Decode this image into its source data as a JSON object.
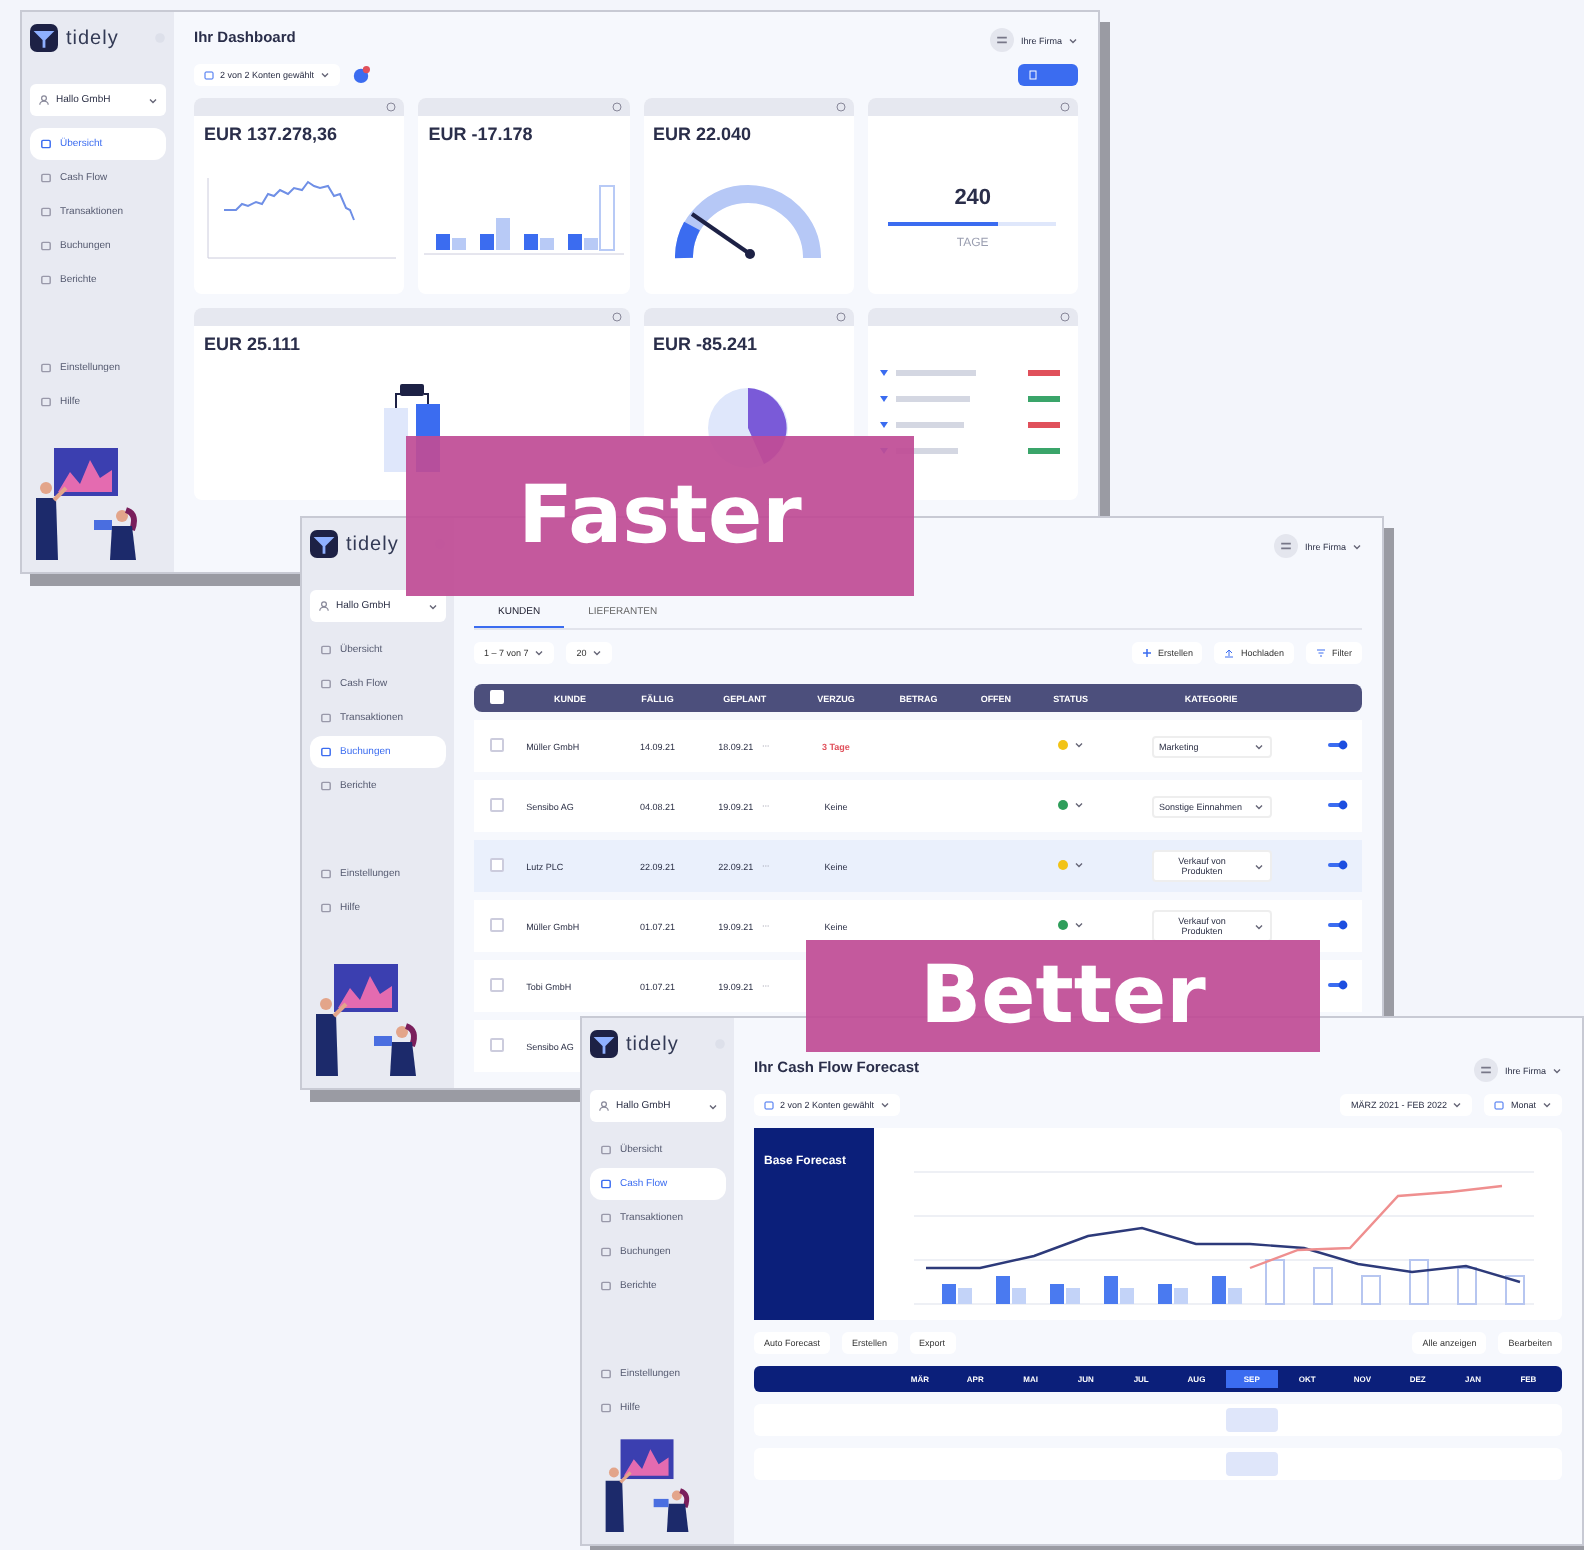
{
  "dashboard_window": {
    "sidebar": {
      "logo": "tidely",
      "company": "Hallo GmbH",
      "items": [
        {
          "label": "Übersicht",
          "selected": true
        },
        {
          "label": "Cash Flow",
          "selected": false
        },
        {
          "label": "Transaktionen",
          "selected": false
        },
        {
          "label": "Buchungen",
          "selected": false
        },
        {
          "label": "Berichte",
          "selected": false
        }
      ],
      "footer_items": [
        {
          "label": "Einstellungen",
          "selected": false
        },
        {
          "label": "Hilfe",
          "selected": false
        }
      ]
    },
    "title": "Ihr Dashboard",
    "user": "Ihre Firma",
    "account_filter": "2 von 2 Konten gewählt",
    "cards": [
      {
        "kind": "line",
        "value": "EUR 137.278,36"
      },
      {
        "kind": "bars",
        "value": "EUR -17.178"
      },
      {
        "kind": "gauge",
        "value": "EUR 22.040"
      },
      {
        "kind": "progress",
        "value": "240",
        "level": 0.65,
        "unit": "TAGE"
      },
      {
        "kind": "pair",
        "value": "EUR 25.111"
      },
      {
        "kind": "pie",
        "value": "EUR -85.241"
      },
      {
        "kind": "list"
      }
    ]
  },
  "invoices_window": {
    "sidebar": {
      "logo": "tidely",
      "company": "Hallo GmbH",
      "items": [
        {
          "label": "Übersicht",
          "selected": false
        },
        {
          "label": "Cash Flow",
          "selected": false
        },
        {
          "label": "Transaktionen",
          "selected": false
        },
        {
          "label": "Buchungen",
          "selected": true
        },
        {
          "label": "Berichte",
          "selected": false
        }
      ],
      "footer_items": [
        {
          "label": "Einstellungen",
          "selected": false
        },
        {
          "label": "Hilfe",
          "selected": false
        }
      ]
    },
    "user": "Ihre Firma",
    "tabs": [
      {
        "label": "KUNDEN",
        "selected": true
      },
      {
        "label": "LIEFERANTEN",
        "selected": false
      }
    ],
    "all_selected": false,
    "pager": "1 – 7 von 7",
    "page_size": "20",
    "actions": [
      "Erstellen",
      "Hochladen",
      "Filter"
    ],
    "columns": [
      "KUNDE",
      "FÄLLIG",
      "GEPLANT",
      "VERZUG",
      "BETRAG",
      "OFFEN",
      "STATUS",
      "KATEGORIE"
    ],
    "rows": [
      {
        "customer": "Müller GmbH",
        "due": "14.09.21",
        "planned": "18.09.21",
        "delay": "3 Tage",
        "overdue": true,
        "color": "#f2c316",
        "category": "Marketing",
        "on": true,
        "selected": false
      },
      {
        "customer": "Sensibo AG",
        "due": "04.08.21",
        "planned": "19.09.21",
        "delay": "Keine",
        "overdue": false,
        "color": "#2f9e5b",
        "category": "Sonstige Einnahmen",
        "on": true,
        "selected": false
      },
      {
        "customer": "Lutz PLC",
        "due": "22.09.21",
        "planned": "22.09.21",
        "delay": "Keine",
        "overdue": false,
        "color": "#f2c316",
        "category": "Verkauf von Produkten",
        "on": true,
        "selected": true
      },
      {
        "customer": "Müller GmbH",
        "due": "01.07.21",
        "planned": "19.09.21",
        "delay": "Keine",
        "overdue": false,
        "color": "#2f9e5b",
        "category": "Verkauf von Produkten",
        "on": true,
        "selected": false
      },
      {
        "customer": "Tobi GmbH",
        "due": "01.07.21",
        "planned": "19.09.21",
        "on": true,
        "selected": false
      },
      {
        "customer": "Sensibo AG",
        "selected": false
      }
    ]
  },
  "forecast_window": {
    "sidebar": {
      "logo": "tidely",
      "company": "Hallo GmbH",
      "items": [
        {
          "label": "Übersicht",
          "selected": false
        },
        {
          "label": "Cash Flow",
          "selected": true
        },
        {
          "label": "Transaktionen",
          "selected": false
        },
        {
          "label": "Buchungen",
          "selected": false
        },
        {
          "label": "Berichte",
          "selected": false
        }
      ],
      "footer_items": [
        {
          "label": "Einstellungen",
          "selected": false
        },
        {
          "label": "Hilfe",
          "selected": false
        }
      ]
    },
    "title": "Ihr Cash Flow Forecast",
    "user": "Ihre Firma",
    "account_filter": "2 von 2 Konten gewählt",
    "period": "MÄRZ 2021 - FEB 2022",
    "interval": "Monat",
    "scenario": "Base Forecast",
    "actions": [
      "Auto Forecast",
      "Erstellen",
      "Export"
    ],
    "right_actions": [
      "Alle anzeigen",
      "Bearbeiten"
    ],
    "months": [
      {
        "label": "MÄR",
        "selected": false
      },
      {
        "label": "APR",
        "selected": false
      },
      {
        "label": "MAI",
        "selected": false
      },
      {
        "label": "JUN",
        "selected": false
      },
      {
        "label": "JUL",
        "selected": false
      },
      {
        "label": "AUG",
        "selected": false
      },
      {
        "label": "SEP",
        "selected": true
      },
      {
        "label": "OKT",
        "selected": false
      },
      {
        "label": "NOV",
        "selected": false
      },
      {
        "label": "DEZ",
        "selected": false
      },
      {
        "label": "JAN",
        "selected": false
      },
      {
        "label": "FEB",
        "selected": false
      }
    ]
  },
  "banners": [
    "Faster",
    "Better"
  ]
}
